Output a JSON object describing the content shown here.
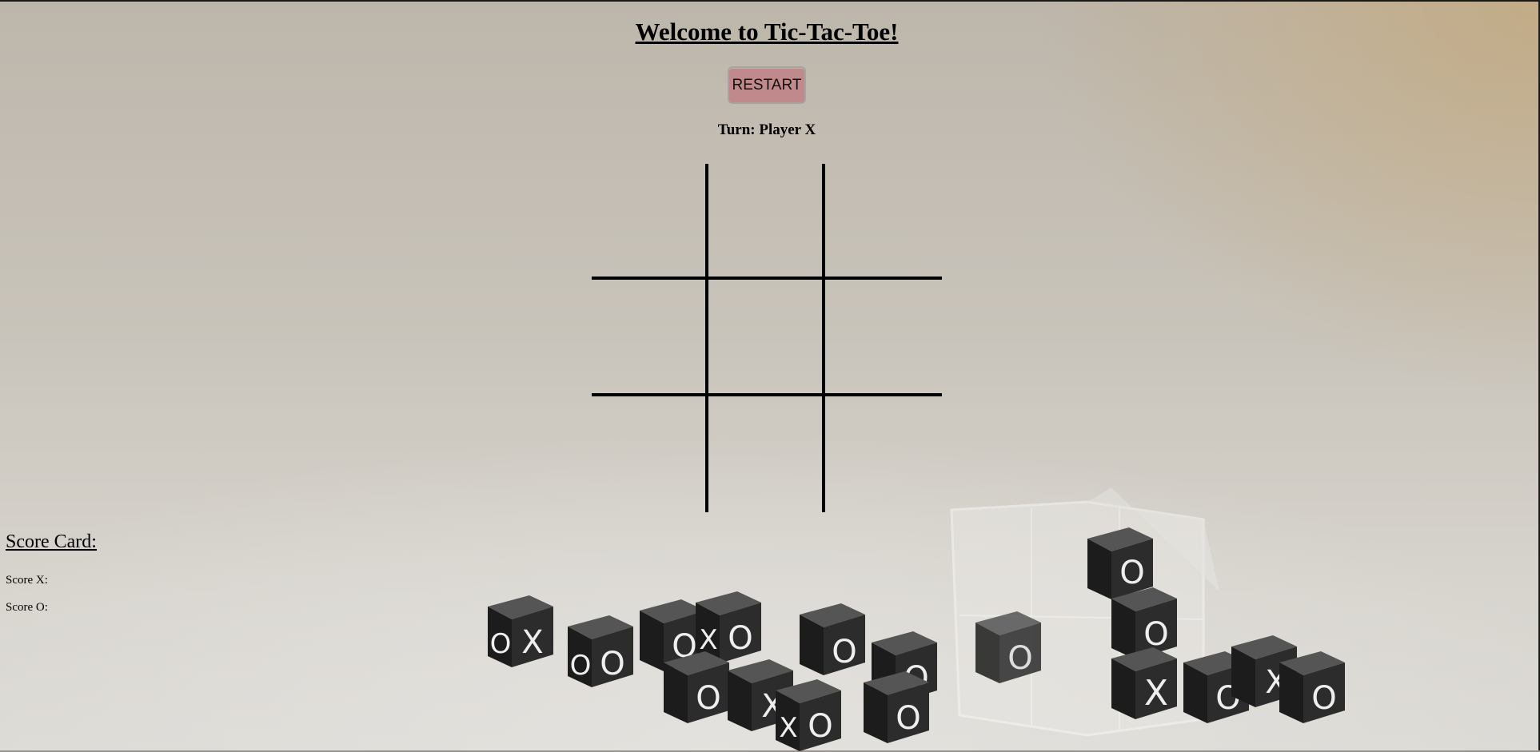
{
  "page": {
    "title": "Welcome to Tic-Tac-Toe!",
    "restart_label": "RESTART",
    "turn_text": "Turn: Player X"
  },
  "board": {
    "cells": [
      "",
      "",
      "",
      "",
      "",
      "",
      "",
      "",
      ""
    ]
  },
  "scorecard": {
    "title": "Score Card:",
    "score_x_label": "Score X:",
    "score_x_value": "",
    "score_o_label": "Score O:",
    "score_o_value": ""
  },
  "colors": {
    "restart_button": "#c08a8c",
    "grid_lines": "#000000",
    "background": "#c9c4bb"
  }
}
